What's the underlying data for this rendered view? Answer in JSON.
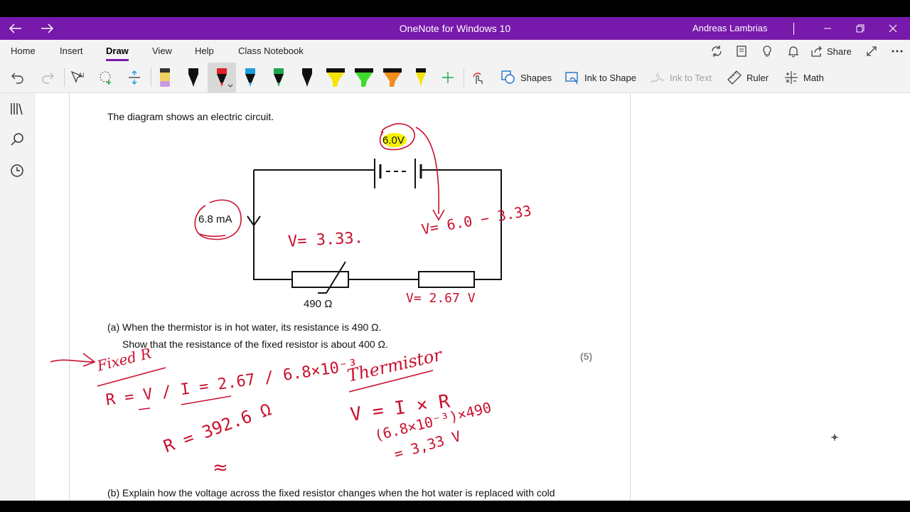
{
  "window": {
    "title": "OneNote for Windows 10",
    "user": "Andreas Lambrias",
    "accent": "#7719aa"
  },
  "menu": {
    "tabs": [
      "Home",
      "Insert",
      "Draw",
      "View",
      "Help",
      "Class Notebook"
    ],
    "active_tab": "Draw",
    "share_label": "Share"
  },
  "toolbar": {
    "shapes_label": "Shapes",
    "ink_to_shape_label": "Ink to Shape",
    "ink_to_text_label": "Ink to Text",
    "ruler_label": "Ruler",
    "math_label": "Math",
    "pens": [
      {
        "name": "pen-black-1",
        "color": "#111111"
      },
      {
        "name": "pen-red",
        "color": "#e0202a"
      },
      {
        "name": "pen-blue",
        "color": "#1e9be0"
      },
      {
        "name": "pen-green",
        "color": "#1aa84a"
      },
      {
        "name": "pen-black-2",
        "color": "#111111"
      },
      {
        "name": "highlighter-yellow",
        "color": "#f5e400"
      },
      {
        "name": "highlighter-green",
        "color": "#3ddc2c"
      },
      {
        "name": "highlighter-orange",
        "color": "#f28c1c"
      },
      {
        "name": "highlighter-yellow-2",
        "color": "#f5e400"
      }
    ]
  },
  "page": {
    "intro": "The diagram shows an electric circuit.",
    "battery_label": "6.0V",
    "current_label": "6.8 mA",
    "thermistor_resistance": "490 Ω",
    "question_a_line1": "(a)  When the thermistor is in hot water, its resistance is 490 Ω.",
    "question_a_line2": "Show that the resistance of the fixed resistor is about 400 Ω.",
    "marks": "(5)",
    "question_b": "(b)  Explain how the voltage across the fixed resistor changes when the hot water is replaced with cold"
  },
  "handwriting": {
    "v_thermistor": "V= 3.33.",
    "v_total": "V= 6.0 − 3.33",
    "v_fixed": "V= 2.67  V",
    "fixed_r_title": "Fixed R",
    "fixed_r_formula": "R = V / I = 2.67 / 6.8×10⁻³",
    "fixed_r_result": "R = 392.6 Ω",
    "approx": "≈",
    "thermistor_title": "Thermistor",
    "thermistor_line1": "V = I × R",
    "thermistor_line2": "(6.8×10⁻³)×490",
    "thermistor_line3": "= 3,33 V",
    "ink_color": "#c8102e",
    "highlight_color": "#f7f300"
  }
}
